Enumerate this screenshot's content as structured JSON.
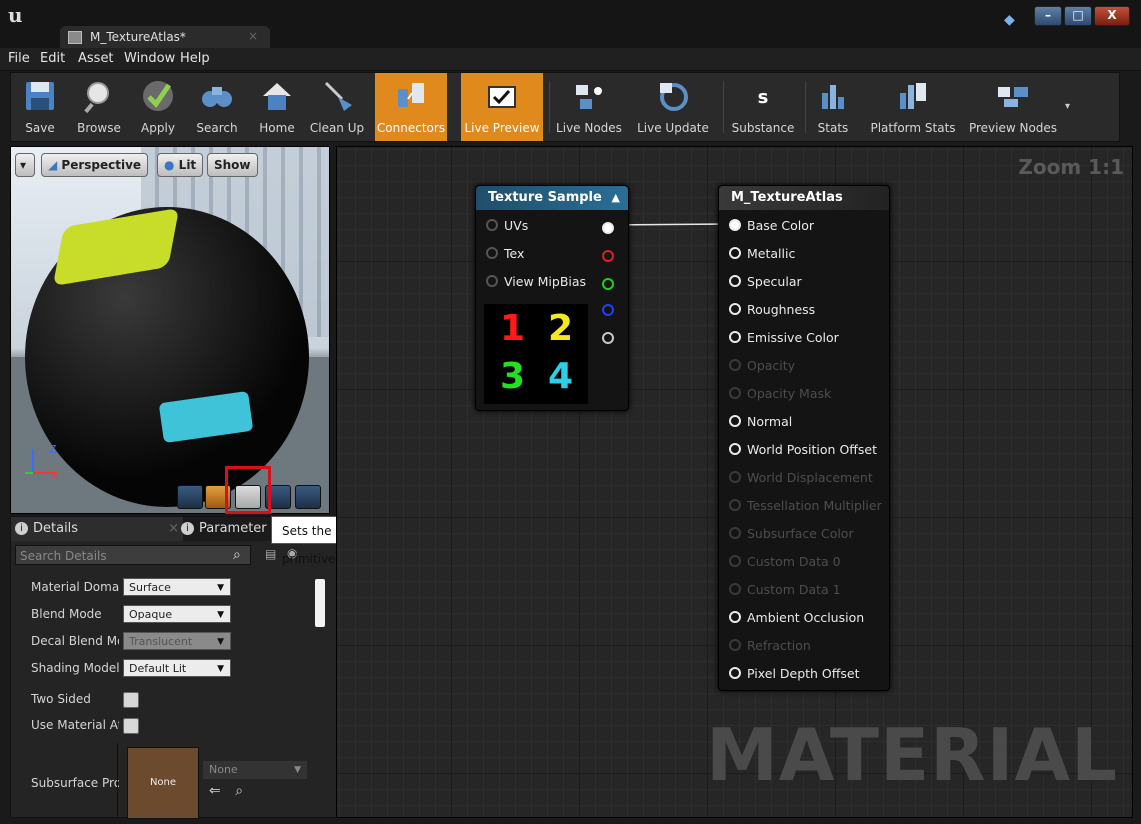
{
  "window": {
    "tab_title": "M_TextureAtlas*",
    "tab_close": "×",
    "minimize": "–",
    "maximize": "□",
    "close": "X"
  },
  "menu": [
    "File",
    "Edit",
    "Asset",
    "Window",
    "Help"
  ],
  "toolbar": {
    "save": "Save",
    "browse": "Browse",
    "apply": "Apply",
    "search": "Search",
    "home": "Home",
    "clean_up": "Clean Up",
    "connectors": "Connectors",
    "live_preview": "Live Preview",
    "live_nodes": "Live Nodes",
    "live_update": "Live Update",
    "substance": "Substance",
    "stats": "Stats",
    "platform_stats": "Platform Stats",
    "preview_nodes": "Preview Nodes"
  },
  "viewport": {
    "perspective": "Perspective",
    "lit": "Lit",
    "show": "Show",
    "axis_z": "Z",
    "axis_x": "X"
  },
  "tooltip": "Sets the preview mesh to a plane primitive.",
  "details": {
    "tab_details": "Details",
    "tab_parameter": "Parameter D",
    "search_placeholder": "Search Details",
    "properties": [
      {
        "label": "Material Domain",
        "value": "Surface"
      },
      {
        "label": "Blend Mode",
        "value": "Opaque"
      },
      {
        "label": "Decal Blend Mode",
        "value": "Translucent"
      },
      {
        "label": "Shading Model",
        "value": "Default Lit"
      },
      {
        "label": "Two Sided",
        "value": ""
      },
      {
        "label": "Use Material Attributes",
        "value": ""
      },
      {
        "label": "Subsurface Profile",
        "value": "None"
      }
    ],
    "sss_thumb": "None",
    "sss_dropdown": "None"
  },
  "graph": {
    "zoom": "Zoom 1:1",
    "watermark": "MATERIAL",
    "texture_node": {
      "title": "Texture Sample",
      "inputs": [
        "UVs",
        "Tex",
        "View MipBias"
      ],
      "numbers": [
        "1",
        "2",
        "3",
        "4"
      ]
    },
    "material_node": {
      "title": "M_TextureAtlas",
      "pins": [
        {
          "label": "Base Color",
          "enabled": true
        },
        {
          "label": "Metallic",
          "enabled": true
        },
        {
          "label": "Specular",
          "enabled": true
        },
        {
          "label": "Roughness",
          "enabled": true
        },
        {
          "label": "Emissive Color",
          "enabled": true
        },
        {
          "label": "Opacity",
          "enabled": false
        },
        {
          "label": "Opacity Mask",
          "enabled": false
        },
        {
          "label": "Normal",
          "enabled": true
        },
        {
          "label": "World Position Offset",
          "enabled": true
        },
        {
          "label": "World Displacement",
          "enabled": false
        },
        {
          "label": "Tessellation Multiplier",
          "enabled": false
        },
        {
          "label": "Subsurface Color",
          "enabled": false
        },
        {
          "label": "Custom Data 0",
          "enabled": false
        },
        {
          "label": "Custom Data 1",
          "enabled": false
        },
        {
          "label": "Ambient Occlusion",
          "enabled": true
        },
        {
          "label": "Refraction",
          "enabled": false
        },
        {
          "label": "Pixel Depth Offset",
          "enabled": true
        }
      ]
    }
  },
  "colors": {
    "accent_orange": "#e08a1e",
    "texture_header": "#1f4e6b",
    "material_header": "#333333",
    "highlight_red": "#d8101a"
  }
}
